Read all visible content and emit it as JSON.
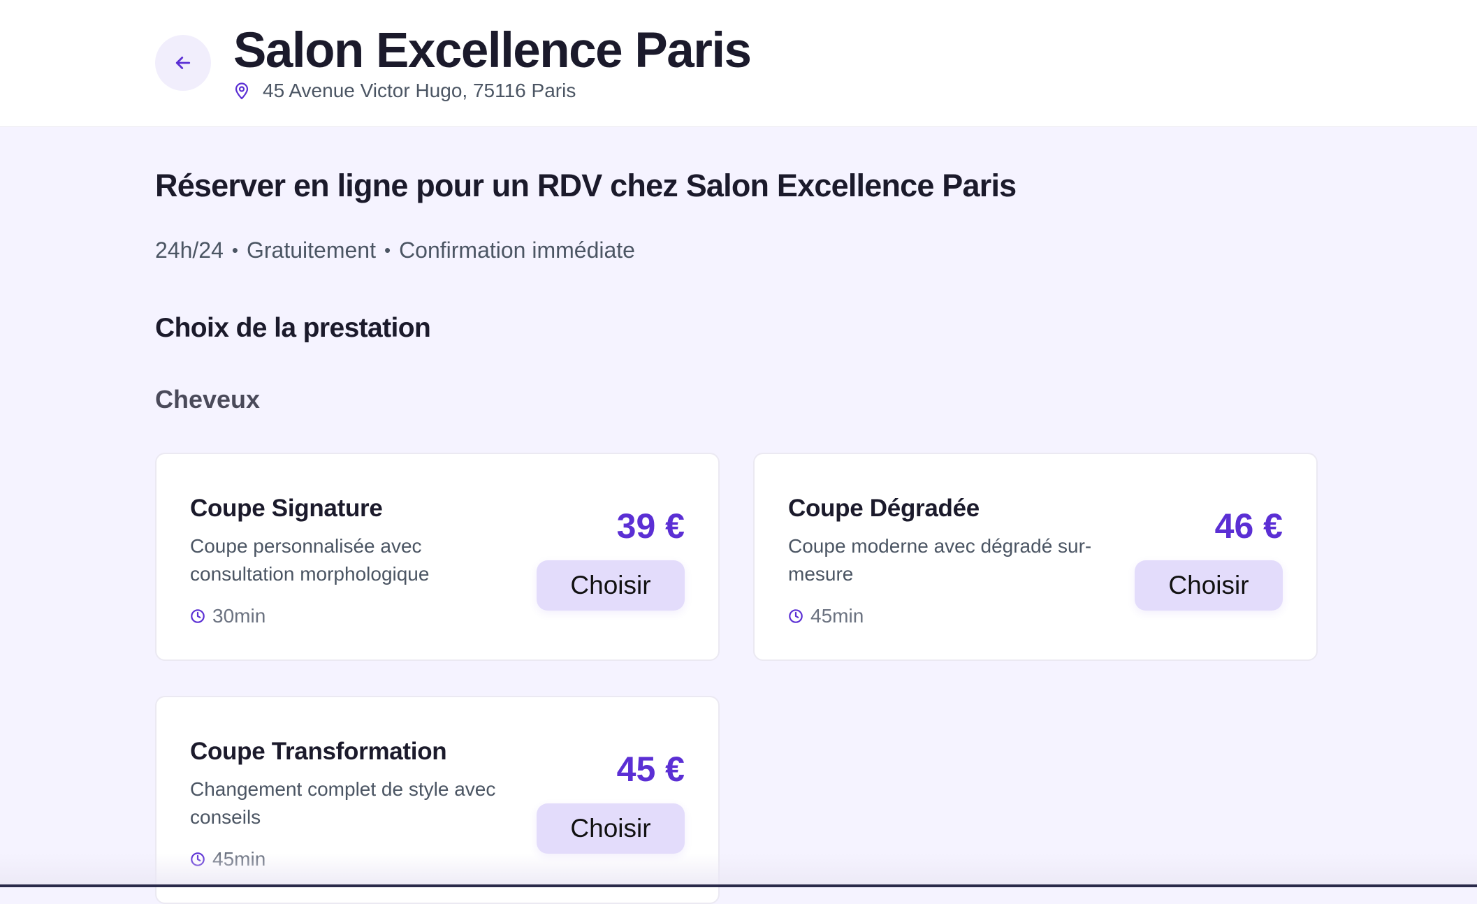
{
  "header": {
    "title": "Salon Excellence Paris",
    "address": "45 Avenue Victor Hugo, 75116 Paris"
  },
  "main": {
    "booking_title": "Réserver en ligne pour un RDV chez Salon Excellence Paris",
    "tagline": [
      "24h/24",
      "Gratuitement",
      "Confirmation immédiate"
    ],
    "section_title": "Choix de la prestation",
    "category": "Cheveux",
    "services": [
      {
        "name": "Coupe Signature",
        "description": "Coupe personnalisée avec consultation morphologique",
        "duration": "30min",
        "price": "39 €",
        "button": "Choisir"
      },
      {
        "name": "Coupe Dégradée",
        "description": "Coupe moderne avec dégradé sur-mesure",
        "duration": "45min",
        "price": "46 €",
        "button": "Choisir"
      },
      {
        "name": "Coupe Transformation",
        "description": "Changement complet de style avec conseils",
        "duration": "45min",
        "price": "45 €",
        "button": "Choisir"
      }
    ]
  },
  "icons": {
    "back": "arrow-left-icon",
    "location": "map-pin-icon",
    "duration": "clock-icon"
  },
  "colors": {
    "accent": "#5b2fd4",
    "button_bg": "#e3dcfb",
    "page_bg": "#f5f3ff"
  }
}
